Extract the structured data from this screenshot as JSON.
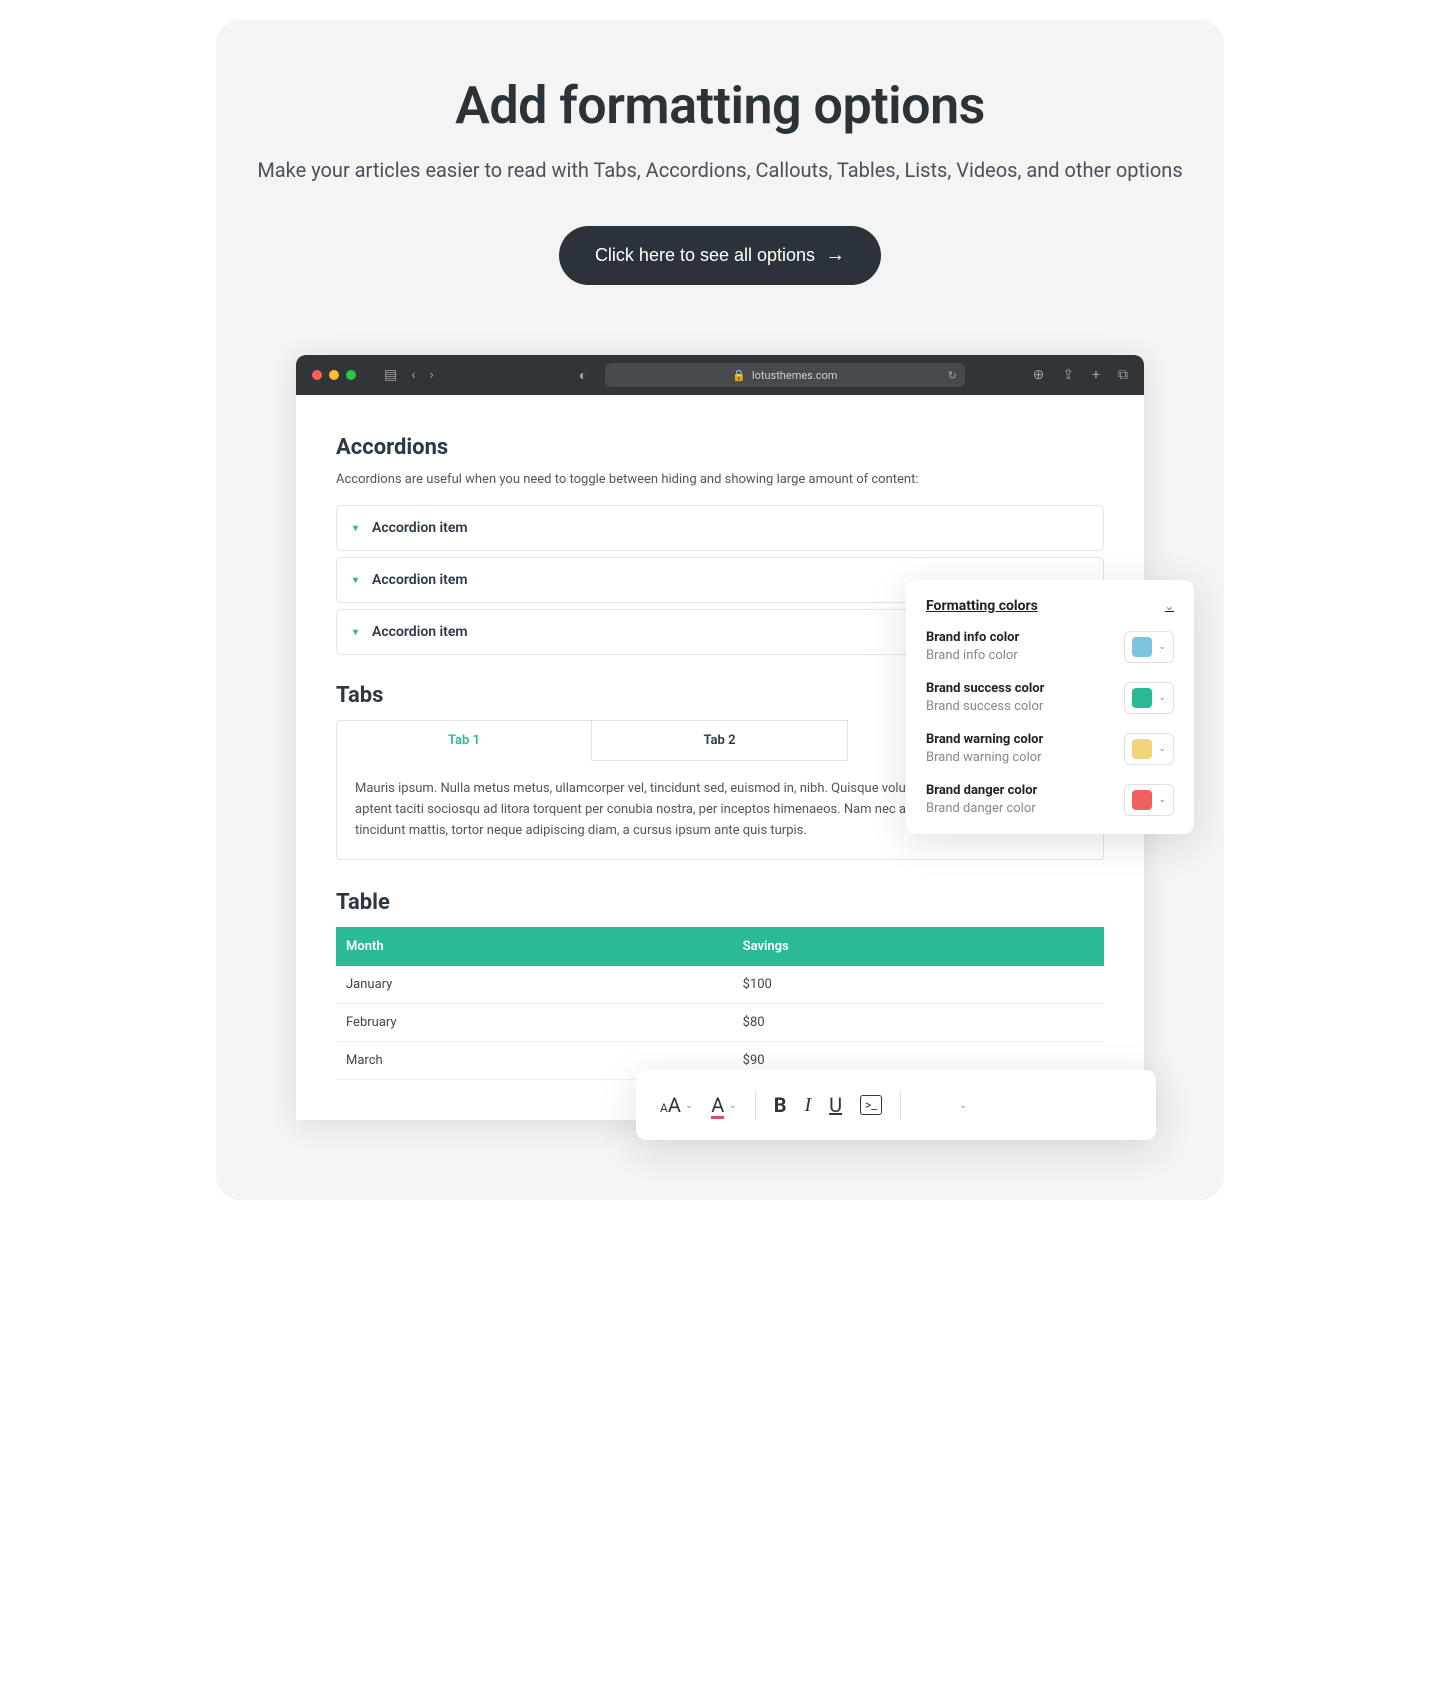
{
  "hero": {
    "title": "Add formatting options",
    "subtitle": "Make your articles easier to read with Tabs, Accordions, Callouts, Tables, Lists, Videos, and other options",
    "cta_label": "Click here to see all options"
  },
  "browser": {
    "url": "lotusthemes.com"
  },
  "accordions": {
    "heading": "Accordions",
    "description": "Accordions are useful when you need to toggle between hiding and showing large amount of content:",
    "items": [
      "Accordion item",
      "Accordion item",
      "Accordion item"
    ]
  },
  "tabs": {
    "heading": "Tabs",
    "tab1_label": "Tab 1",
    "tab2_label": "Tab 2",
    "tab1_content": "Mauris ipsum. Nulla metus metus, ullamcorper vel, tincidunt sed, euismod in, nibh. Quisque volutpat condimentum velit. Class aptent taciti sociosqu ad litora torquent per conubia nostra, per inceptos himenaeos. Nam nec ante. Sed lacinia, urna non tincidunt mattis, tortor neque adipiscing diam, a cursus ipsum ante quis turpis."
  },
  "table": {
    "heading": "Table",
    "columns": [
      "Month",
      "Savings"
    ],
    "rows": [
      {
        "month": "January",
        "savings": "$100"
      },
      {
        "month": "February",
        "savings": "$80"
      },
      {
        "month": "March",
        "savings": "$90"
      }
    ]
  },
  "colors_panel": {
    "title": "Formatting colors",
    "items": [
      {
        "title": "Brand info color",
        "subtitle": "Brand info color",
        "color": "#7ec3e0"
      },
      {
        "title": "Brand success color",
        "subtitle": "Brand success color",
        "color": "#2bbb94"
      },
      {
        "title": "Brand warning color",
        "subtitle": "Brand warning color",
        "color": "#f2d37a"
      },
      {
        "title": "Brand danger color",
        "subtitle": "Brand danger color",
        "color": "#f06060"
      }
    ]
  }
}
